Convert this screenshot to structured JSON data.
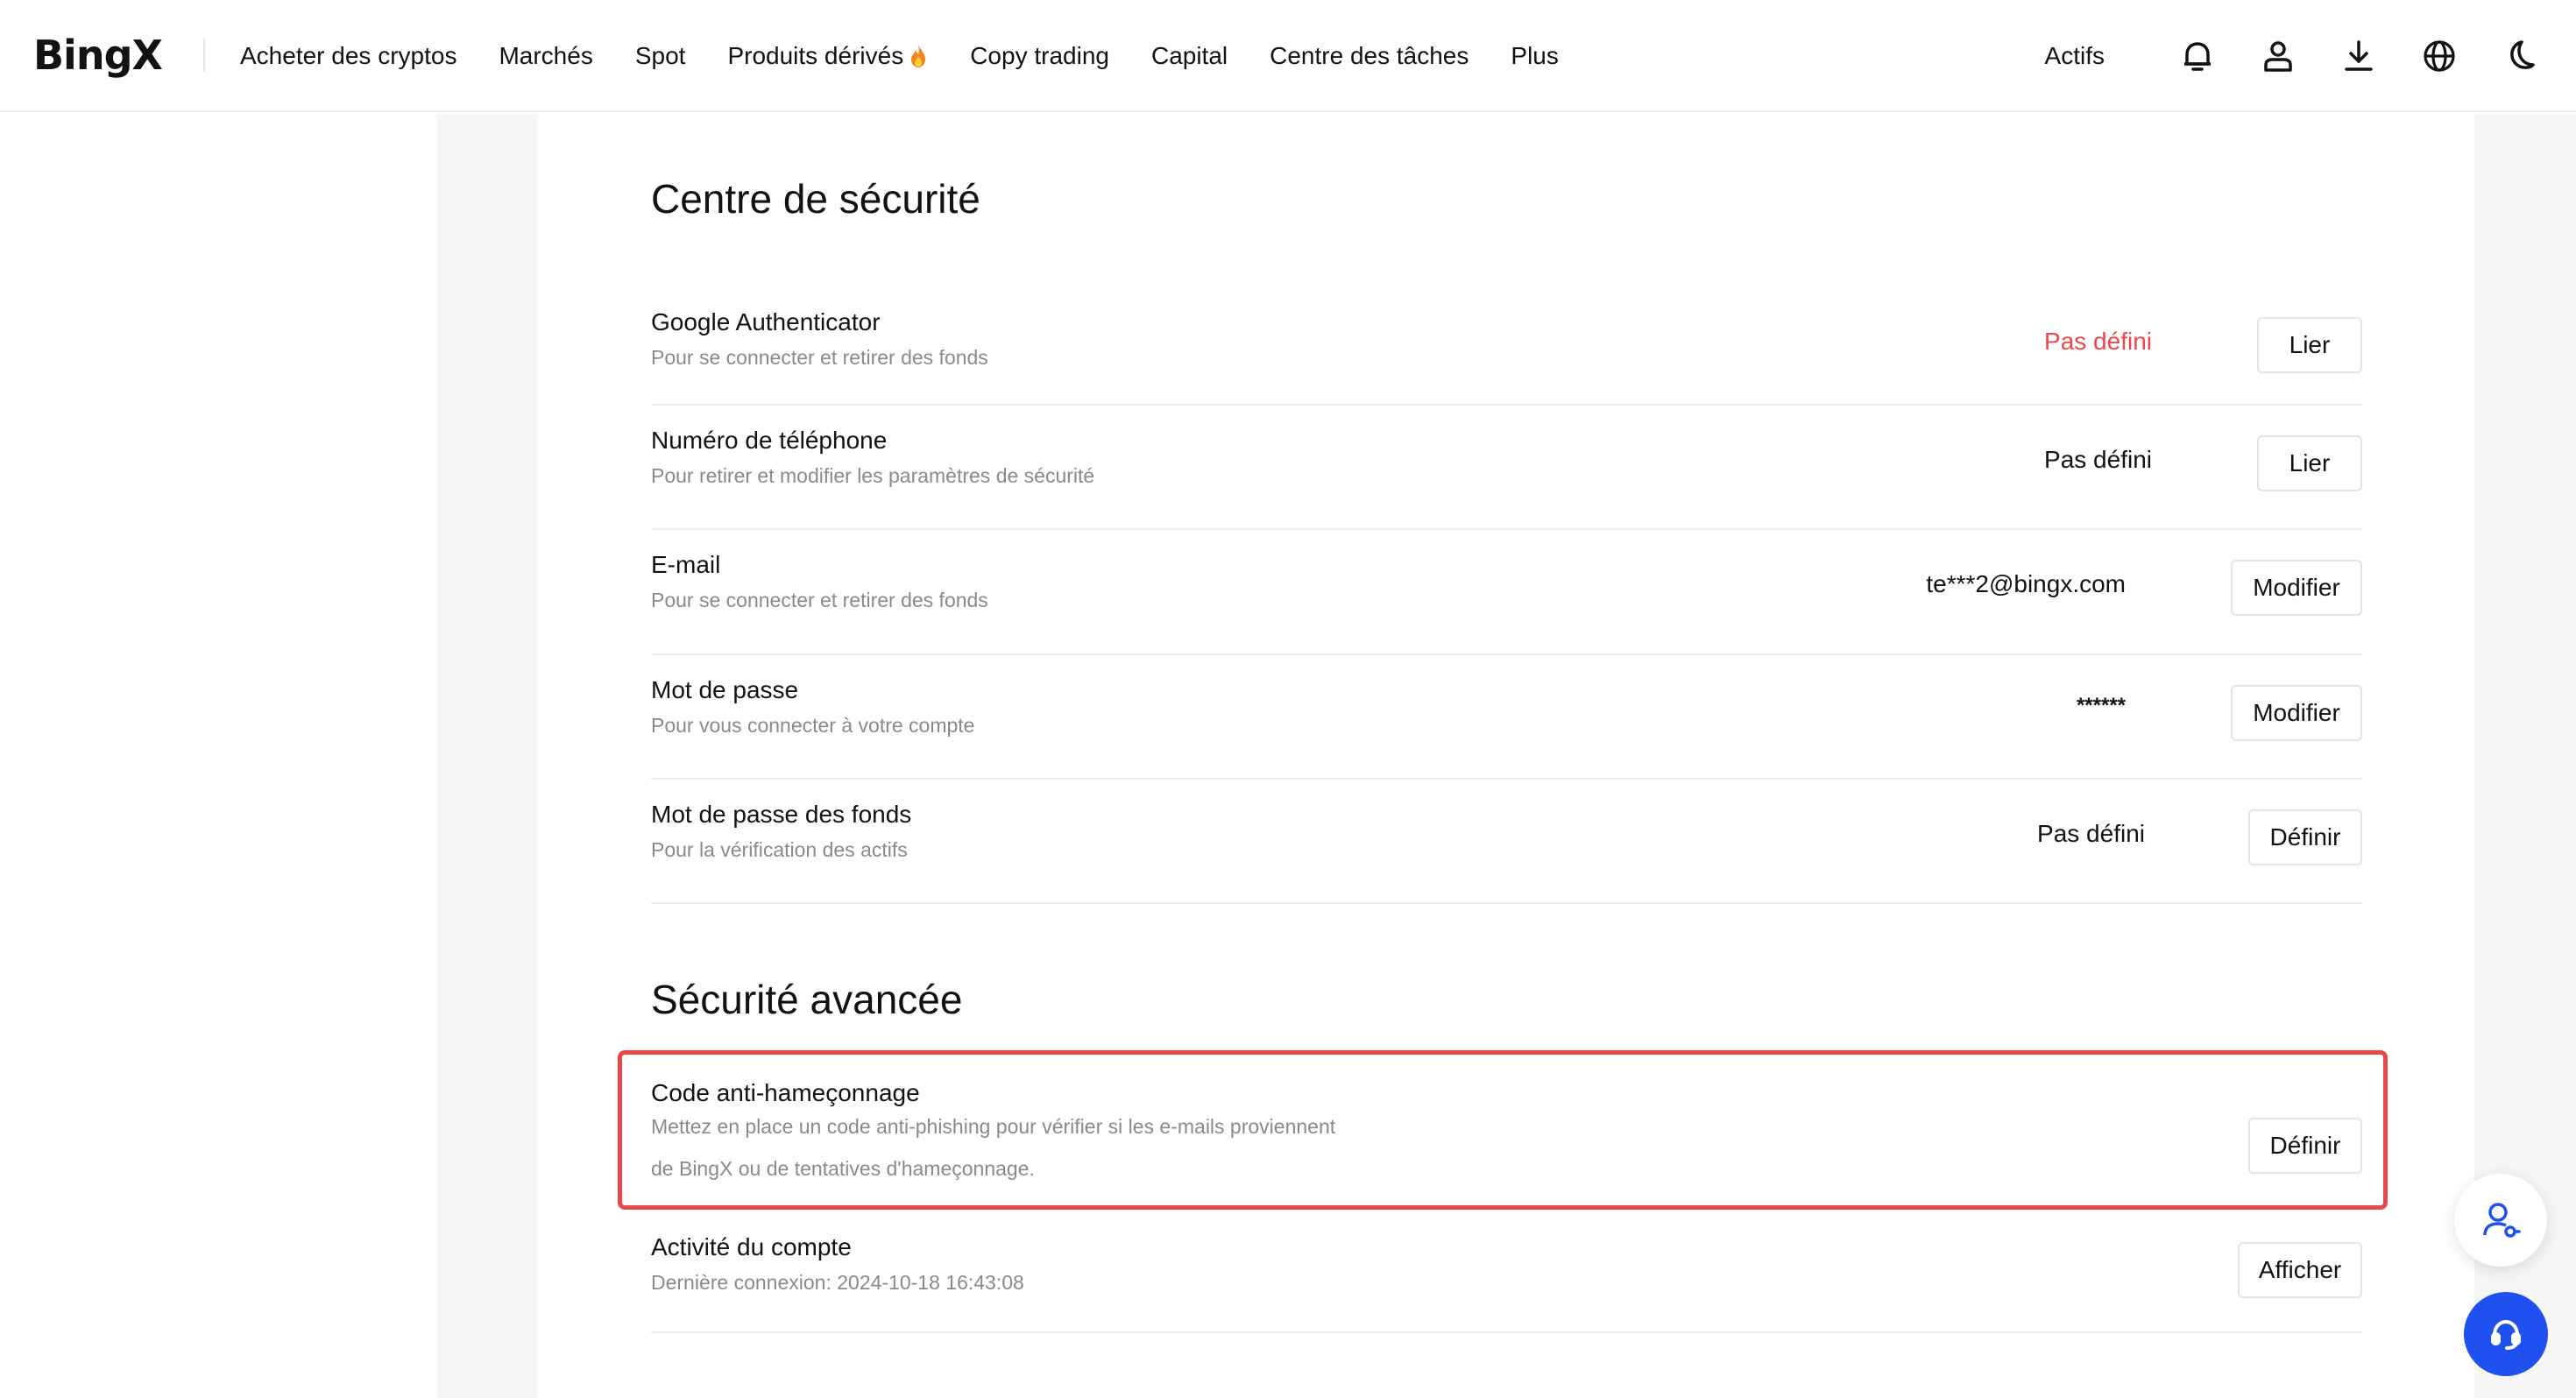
{
  "header": {
    "logo": "BingX",
    "nav": [
      "Acheter des cryptos",
      "Marchés",
      "Spot",
      "Produits dérivés",
      "Copy trading",
      "Capital",
      "Centre des tâches",
      "Plus"
    ],
    "actifs": "Actifs"
  },
  "security": {
    "title": "Centre de sécurité",
    "rows": [
      {
        "title": "Google Authenticator",
        "desc": "Pour se connecter et retirer des fonds",
        "status": "Pas défini",
        "button": "Lier"
      },
      {
        "title": "Numéro de téléphone",
        "desc": "Pour retirer et modifier les paramètres de sécurité",
        "status": "Pas défini",
        "button": "Lier"
      },
      {
        "title": "E-mail",
        "desc": "Pour se connecter et retirer des fonds",
        "status": "te***2@bingx.com",
        "button": "Modifier"
      },
      {
        "title": "Mot de passe",
        "desc": "Pour vous connecter à votre compte",
        "status": "******",
        "button": "Modifier"
      },
      {
        "title": "Mot de passe des fonds",
        "desc": "Pour la vérification des actifs",
        "status": "Pas défini",
        "button": "Définir"
      }
    ]
  },
  "advanced": {
    "title": "Sécurité avancée",
    "rows": [
      {
        "title": "Code anti-hameçonnage",
        "desc_line1": "Mettez en place un code anti-phishing pour vérifier si les e-mails proviennent",
        "desc_line2": "de BingX ou de tentatives d'hameçonnage.",
        "button": "Définir"
      },
      {
        "title": "Activité du compte",
        "desc": "Dernière connexion: 2024-10-18 16:43:08",
        "button": "Afficher"
      }
    ]
  },
  "colors": {
    "accent": "#1f50f0",
    "alert": "#f0454c",
    "highlight": "#e84848"
  }
}
